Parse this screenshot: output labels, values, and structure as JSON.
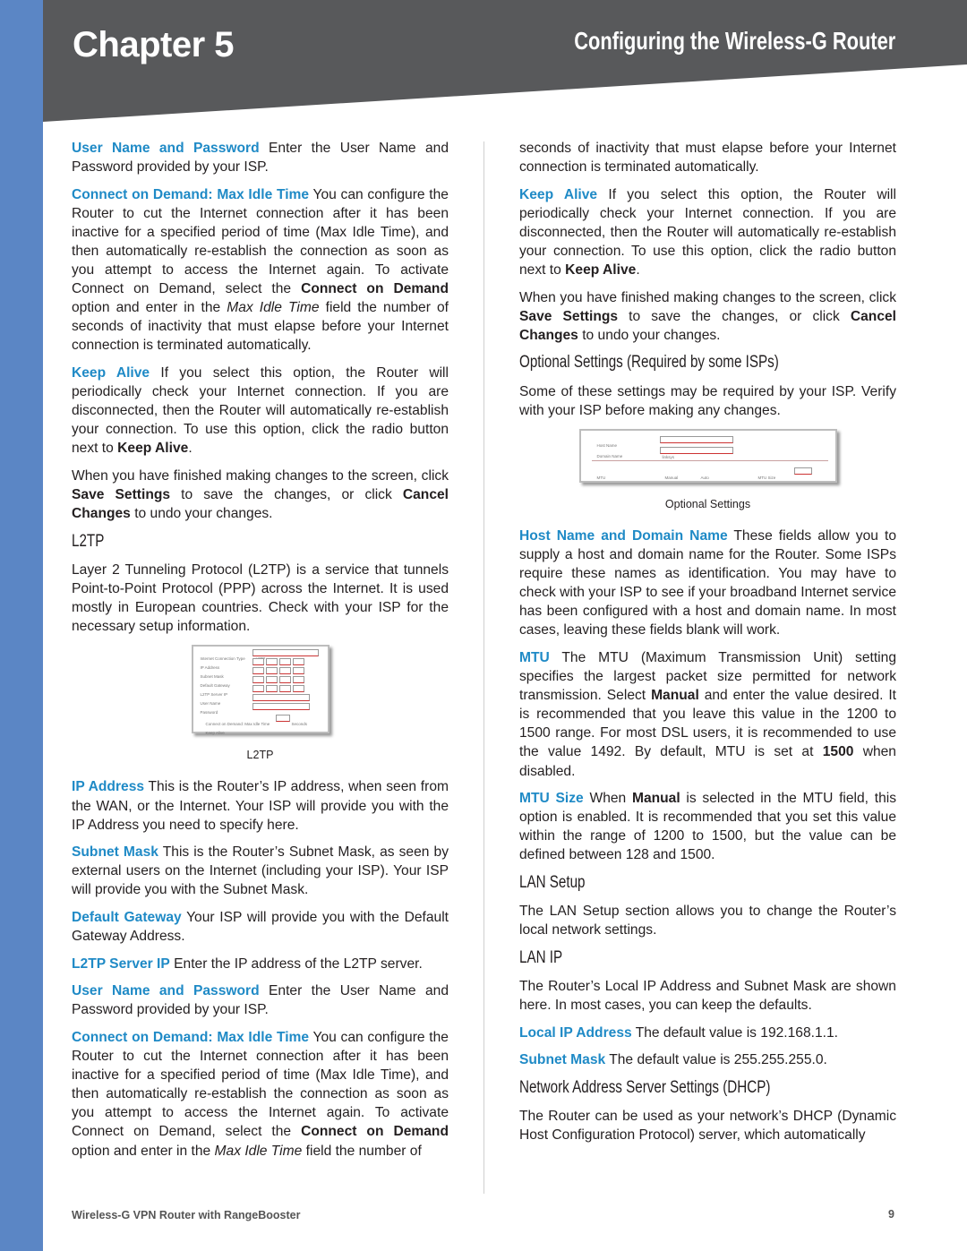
{
  "header": {
    "chapter": "Chapter 5",
    "title": "Configuring the Wireless-G Router"
  },
  "colors": {
    "accent": "#1f8ac6",
    "banner": "#58595b",
    "sidebar": "#5b86c5"
  },
  "columns": [
    [
      {
        "type": "p",
        "seg": [
          {
            "s": "hl",
            "t": "User Name and Password"
          },
          {
            "t": " Enter the User Name and Password provided by your ISP."
          }
        ]
      },
      {
        "type": "p",
        "seg": [
          {
            "s": "hl",
            "t": "Connect on Demand: Max Idle Time"
          },
          {
            "t": "  You can configure the Router to cut the Internet connection after it has been inactive for a specified period of time (Max Idle Time), and then automatically re-establish the connection as soon as you attempt to access the Internet again. To activate Connect on Demand, select the "
          },
          {
            "s": "b",
            "t": "Connect on Demand"
          },
          {
            "t": " option and enter in the "
          },
          {
            "s": "i",
            "t": "Max Idle Time"
          },
          {
            "t": " field the number of seconds of inactivity that must elapse before your Internet connection is terminated automatically."
          }
        ]
      },
      {
        "type": "p",
        "seg": [
          {
            "s": "hl",
            "t": "Keep Alive"
          },
          {
            "t": " If you select this option, the Router will periodically check your Internet connection. If you are disconnected, then the Router will automatically re-establish your connection. To use this option, click the radio button next to "
          },
          {
            "s": "b",
            "t": "Keep Alive"
          },
          {
            "t": "."
          }
        ]
      },
      {
        "type": "p",
        "seg": [
          {
            "t": "When you have finished making changes to the screen, click "
          },
          {
            "s": "b",
            "t": "Save Settings"
          },
          {
            "t": " to save the changes, or click "
          },
          {
            "s": "b",
            "t": "Cancel Changes"
          },
          {
            "t": " to undo your changes."
          }
        ]
      },
      {
        "type": "h",
        "text": "L2TP"
      },
      {
        "type": "p",
        "seg": [
          {
            "t": "Layer 2 Tunneling Protocol (L2TP) is a service that tunnels Point-to-Point Protocol (PPP) across the Internet. It is used mostly in European countries. Check with your ISP for the necessary setup information."
          }
        ]
      },
      {
        "type": "fig",
        "kind": "l2tp",
        "caption": "L2TP",
        "labels": [
          "Internet Connection Type",
          "IP Address",
          "Subnet Mask",
          "Default Gateway",
          "L2TP Server IP",
          "User Name",
          "Password",
          "Connect on Demand: Max Idle Time",
          "Seconds",
          "Keep Alive"
        ],
        "value": "L2TP"
      },
      {
        "type": "p",
        "seg": [
          {
            "s": "hl",
            "t": "IP Address"
          },
          {
            "t": " This is the Router’s IP address, when seen from the WAN, or the Internet. Your ISP will provide you with the IP Address you need to specify here."
          }
        ]
      },
      {
        "type": "p",
        "seg": [
          {
            "s": "hl",
            "t": "Subnet Mask"
          },
          {
            "t": " This is the Router’s Subnet Mask, as seen by external users on the Internet (including your ISP). Your ISP will provide you with the Subnet Mask."
          }
        ]
      },
      {
        "type": "p",
        "seg": [
          {
            "s": "hl",
            "t": "Default Gateway"
          },
          {
            "t": " Your ISP will provide you with the Default Gateway Address."
          }
        ]
      },
      {
        "type": "p",
        "seg": [
          {
            "s": "hl",
            "t": "L2TP Server IP"
          },
          {
            "t": "  Enter the IP address of the L2TP server."
          }
        ]
      },
      {
        "type": "p",
        "seg": [
          {
            "s": "hl",
            "t": "User Name and Password"
          },
          {
            "t": " Enter the User Name and Password provided by your ISP."
          }
        ]
      },
      {
        "type": "p",
        "seg": [
          {
            "s": "hl",
            "t": "Connect on Demand: Max Idle Time"
          },
          {
            "t": "  You can configure the Router to cut the Internet connection after it has been inactive for a specified period of time (Max Idle Time), and then automatically re-establish the connection as soon as you attempt to access the Internet again. To activate Connect on Demand, select the "
          },
          {
            "s": "b",
            "t": "Connect on Demand"
          },
          {
            "t": " option and enter in the "
          },
          {
            "s": "i",
            "t": "Max Idle Time"
          },
          {
            "t": " field the number of"
          }
        ]
      }
    ],
    [
      {
        "type": "p",
        "seg": [
          {
            "t": "seconds of inactivity that must elapse before your Internet connection is terminated automatically."
          }
        ]
      },
      {
        "type": "p",
        "seg": [
          {
            "s": "hl",
            "t": "Keep Alive"
          },
          {
            "t": " If you select this option, the Router will periodically check your Internet connection. If you are disconnected, then the Router will automatically re-establish your connection. To use this option, click the radio button next to "
          },
          {
            "s": "b",
            "t": "Keep Alive"
          },
          {
            "t": "."
          }
        ]
      },
      {
        "type": "p",
        "seg": [
          {
            "t": "When you have finished making changes to the screen, click "
          },
          {
            "s": "b",
            "t": "Save Settings"
          },
          {
            "t": " to save the changes, or click "
          },
          {
            "s": "b",
            "t": "Cancel Changes"
          },
          {
            "t": " to undo your changes."
          }
        ]
      },
      {
        "type": "h",
        "text": "Optional Settings (Required by some ISPs)"
      },
      {
        "type": "p",
        "seg": [
          {
            "t": "Some of these settings may be required by your ISP. Verify with your ISP before making any changes."
          }
        ]
      },
      {
        "type": "fig",
        "kind": "optional",
        "caption": "Optional Settings",
        "labels": [
          "Host Name",
          "Domain Name",
          "MTU",
          "Manual",
          "Auto",
          "MTU Size"
        ],
        "value": "linksys"
      },
      {
        "type": "p",
        "seg": [
          {
            "s": "hl",
            "t": "Host Name and Domain Name"
          },
          {
            "t": "  These fields allow you to supply a host and domain name for the Router. Some ISPs require these names as identification. You may have to check with your ISP to see if your broadband Internet service has been configured with a host and domain name. In most cases, leaving these fields blank will work."
          }
        ]
      },
      {
        "type": "p",
        "seg": [
          {
            "s": "hl",
            "t": "MTU"
          },
          {
            "t": " The MTU (Maximum Transmission Unit) setting specifies the largest packet size permitted for network transmission. Select "
          },
          {
            "s": "b",
            "t": "Manual"
          },
          {
            "t": " and enter the value desired. It is recommended that you leave this value in the 1200 to 1500 range. For most DSL users, it is recommended to use the value 1492. By default, MTU is set at "
          },
          {
            "s": "b",
            "t": "1500"
          },
          {
            "t": " when disabled."
          }
        ]
      },
      {
        "type": "p",
        "seg": [
          {
            "s": "hl",
            "t": "MTU Size"
          },
          {
            "t": "  When "
          },
          {
            "s": "b",
            "t": "Manual"
          },
          {
            "t": " is selected in the MTU field, this option is enabled. It is recommended that you set this value within the range of 1200 to 1500, but the value can be defined between 128 and 1500."
          }
        ]
      },
      {
        "type": "h",
        "text": "LAN Setup"
      },
      {
        "type": "p",
        "seg": [
          {
            "t": "The LAN Setup section allows you to change the Router’s local network settings."
          }
        ]
      },
      {
        "type": "h",
        "text": "LAN IP"
      },
      {
        "type": "p",
        "seg": [
          {
            "t": "The Router’s Local IP Address and Subnet Mask are shown here. In most cases, you can keep the defaults."
          }
        ]
      },
      {
        "type": "p",
        "seg": [
          {
            "s": "hl",
            "t": "Local IP Address"
          },
          {
            "t": "  The default value is 192.168.1.1."
          }
        ]
      },
      {
        "type": "p",
        "seg": [
          {
            "s": "hl",
            "t": "Subnet Mask"
          },
          {
            "t": "  The default value is 255.255.255.0."
          }
        ]
      },
      {
        "type": "h",
        "text": "Network Address Server Settings (DHCP)"
      },
      {
        "type": "p",
        "seg": [
          {
            "t": "The Router can be used as your network’s DHCP (Dynamic Host Configuration Protocol) server, which automatically"
          }
        ]
      }
    ]
  ],
  "footer": {
    "product": "Wireless-G VPN Router with RangeBooster",
    "page": "9"
  }
}
